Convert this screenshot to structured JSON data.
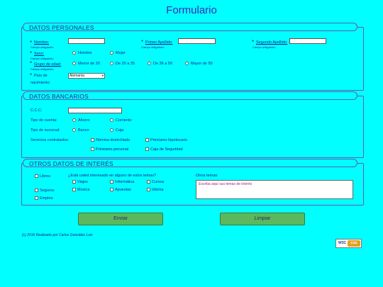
{
  "title": "Formulario",
  "personal": {
    "legend": "DATOS PERSONALES",
    "nombre_label": "Nombre:",
    "apellido1_label": "Primer Apellido:",
    "apellido2_label": "Segundo Apellido:",
    "required_note": "Campo obligatorio",
    "sexo_label": "Sexo:",
    "sexo_options": [
      "Hombre",
      "Mujer"
    ],
    "edad_label": "Grupo de edad:",
    "edad_options": [
      "Menor de 20",
      "De 20 a 35",
      "De 36 a 50",
      "Mayor de 50"
    ],
    "pais_label_1": "País de",
    "pais_label_2": "nacimiento:",
    "pais_value": "Alemania"
  },
  "bancarios": {
    "legend": "DATOS BANCARIOS",
    "ccc_label": "C.C.C:",
    "cuenta_label": "Tipo de cuenta:",
    "cuenta_options": [
      "Ahorro",
      "Corriente"
    ],
    "sucursal_label": "Tipo de sucursal:",
    "sucursal_options": [
      "Banco",
      "Caja"
    ],
    "servicios_label": "Servicios contratados:",
    "servicios_options": [
      "Nómina domiciliada",
      "Préstamo hipotecario",
      "Préstamo personal",
      "Caja de Seguridad"
    ]
  },
  "interes": {
    "legend": "OTROS DATOS DE INTERÉS",
    "left_options": [
      "Libros",
      "Seguros",
      "Empleo"
    ],
    "question": "¿Está usted interesado en alguno de estos temas?",
    "temas": [
      "Viajes",
      "Informática",
      "Cursos",
      "Musica",
      "Apuestas",
      "Idioma"
    ],
    "otros_label": "Otros temas:",
    "otros_placeholder": "Escriba aquí sus temas de interés"
  },
  "buttons": {
    "enviar": "Enviar",
    "limpiar": "Limpiar"
  },
  "footer": "(c) 2016 Realizado por Carlos González Luis",
  "badge": {
    "w3c": "W3C",
    "css": "css"
  }
}
